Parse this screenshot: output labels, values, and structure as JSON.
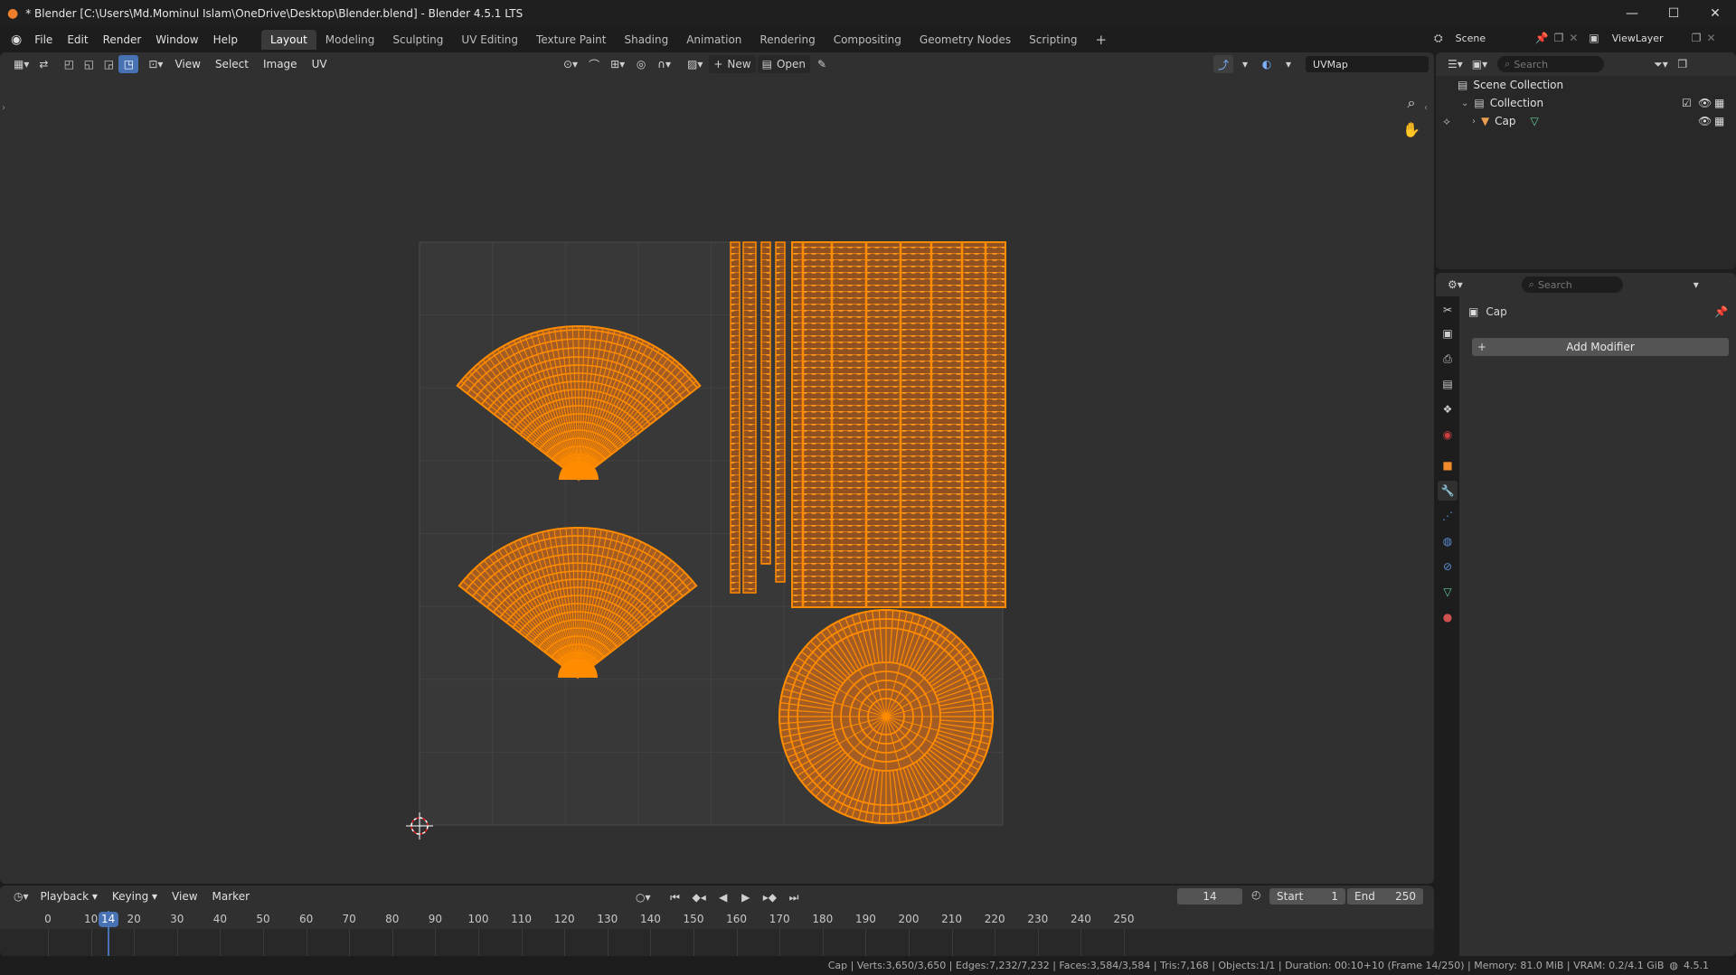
{
  "window": {
    "title": "* Blender [C:\\Users\\Md.Mominul Islam\\OneDrive\\Desktop\\Blender.blend] - Blender 4.5.1 LTS",
    "minimize": "—",
    "maximize": "☐",
    "close": "✕"
  },
  "menu": {
    "items": [
      "File",
      "Edit",
      "Render",
      "Window",
      "Help"
    ]
  },
  "workspaces": {
    "tabs": [
      "Layout",
      "Modeling",
      "Sculpting",
      "UV Editing",
      "Texture Paint",
      "Shading",
      "Animation",
      "Rendering",
      "Compositing",
      "Geometry Nodes",
      "Scripting"
    ],
    "active": "Layout",
    "add": "+"
  },
  "uv_header": {
    "menus": [
      "View",
      "Select",
      "Image",
      "UV"
    ],
    "new_label": "New",
    "open_label": "Open",
    "uvmap": "UVMap",
    "scene_label": "Scene",
    "viewlayer_label": "ViewLayer"
  },
  "timeline": {
    "menus": [
      "Playback",
      "Keying",
      "View",
      "Marker"
    ],
    "current_frame": 14,
    "start_label": "Start",
    "start": 1,
    "end_label": "End",
    "end": 250,
    "ticks": [
      0,
      10,
      20,
      30,
      40,
      50,
      60,
      70,
      80,
      90,
      100,
      110,
      120,
      130,
      140,
      150,
      160,
      170,
      180,
      190,
      200,
      210,
      220,
      230,
      240,
      250
    ]
  },
  "outliner": {
    "search_placeholder": "Search",
    "scene_collection": "Scene Collection",
    "collection": "Collection",
    "object": "Cap"
  },
  "properties": {
    "search_placeholder": "Search",
    "object_name": "Cap",
    "add_modifier": "Add Modifier"
  },
  "status": {
    "text": "Cap | Verts:3,650/3,650 | Edges:7,232/7,232 | Faces:3,584/3,584 | Tris:7,168 | Objects:1/1 | Duration: 00:10+10 (Frame 14/250) | Memory: 81.0 MiB | VRAM: 0.2/4.1 GiB",
    "version": "4.5.1"
  },
  "colors": {
    "uv_fill": "#a35d24",
    "uv_edge": "#ff8c00",
    "accent": "#4772b3",
    "panel": "#303030"
  }
}
